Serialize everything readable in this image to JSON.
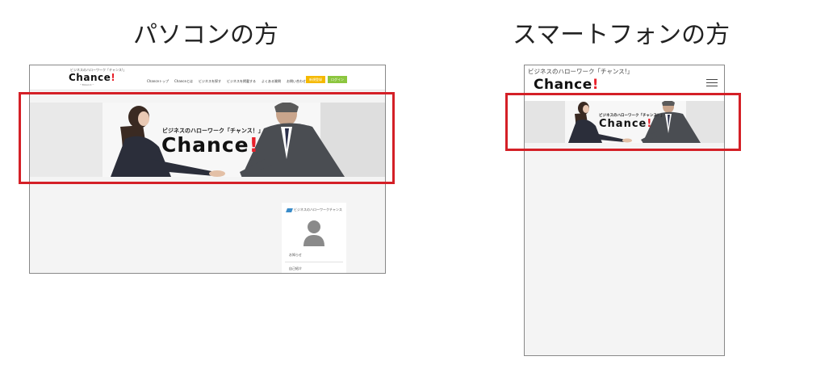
{
  "headings": {
    "pc": "パソコンの方",
    "sp": "スマートフォンの方"
  },
  "site": {
    "tagline": "ビジネスのハローワーク「チャンス!」",
    "logo_text": "Chance",
    "logo_mark": "!",
    "logo_sub": "─ Bizwork ─",
    "hero_tagline": "ビジネスのハローワーク「チャンス！」",
    "hero_title": "Chance",
    "hero_mark": "!"
  },
  "pc": {
    "nav": [
      "Chanceトップ",
      "Chanceとは",
      "ビジネスを探す",
      "ビジネスを掲載する",
      "よくある質問",
      "お問い合わせ"
    ],
    "buttons": {
      "register": "新規登録",
      "login": "ログイン"
    },
    "widget": {
      "brand": "ビジネスのハローワークチャンス",
      "items": [
        "お知らせ",
        "自己紹介"
      ]
    }
  },
  "colors": {
    "highlight": "#d42027",
    "accent_red": "#e8202a",
    "btn_yellow": "#f5b900",
    "btn_green": "#8cc63f"
  },
  "icons": {
    "menu": "hamburger-menu-icon",
    "avatar": "person-avatar-icon",
    "brand": "diamond-logo-icon"
  }
}
